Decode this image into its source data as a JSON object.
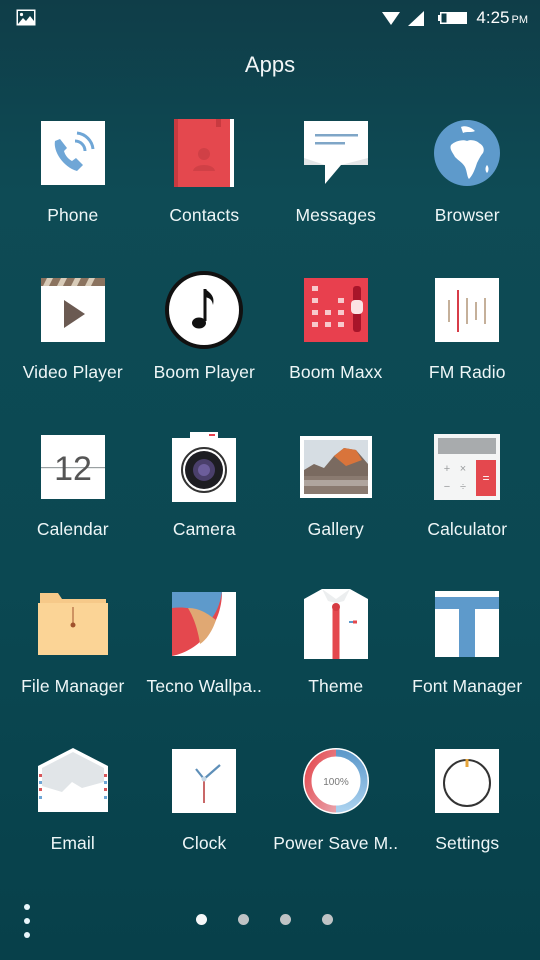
{
  "status_bar": {
    "notification_icon": "image-icon",
    "wifi_icon": "wifi-icon",
    "signal_icon": "cellular-signal-icon",
    "battery_icon": "battery-icon",
    "time": "4:25",
    "ampm": "PM"
  },
  "header": {
    "title": "Apps"
  },
  "apps": [
    {
      "label": "Phone",
      "icon": "phone-icon"
    },
    {
      "label": "Contacts",
      "icon": "contacts-icon"
    },
    {
      "label": "Messages",
      "icon": "messages-icon"
    },
    {
      "label": "Browser",
      "icon": "globe-icon"
    },
    {
      "label": "Video Player",
      "icon": "video-player-icon"
    },
    {
      "label": "Boom Player",
      "icon": "music-note-icon"
    },
    {
      "label": "Boom Maxx",
      "icon": "equalizer-icon"
    },
    {
      "label": "FM Radio",
      "icon": "radio-icon"
    },
    {
      "label": "Calendar",
      "icon": "calendar-icon",
      "date": "12"
    },
    {
      "label": "Camera",
      "icon": "camera-icon"
    },
    {
      "label": "Gallery",
      "icon": "gallery-icon"
    },
    {
      "label": "Calculator",
      "icon": "calculator-icon"
    },
    {
      "label": "File Manager",
      "icon": "folder-icon"
    },
    {
      "label": "Tecno Wallpa..",
      "icon": "wallpaper-icon"
    },
    {
      "label": "Theme",
      "icon": "shirt-icon"
    },
    {
      "label": "Font Manager",
      "icon": "font-icon"
    },
    {
      "label": "Email",
      "icon": "envelope-icon"
    },
    {
      "label": "Clock",
      "icon": "clock-icon"
    },
    {
      "label": "Power Save M..",
      "icon": "battery-gauge-icon",
      "percent": "100%"
    },
    {
      "label": "Settings",
      "icon": "settings-dial-icon"
    }
  ],
  "calculator_keys": [
    "+",
    "×",
    "−",
    "÷",
    "="
  ],
  "footer": {
    "menu_icon": "more-vert-icon",
    "pages": 4,
    "active_page": 1
  },
  "colors": {
    "background": "#0b4852",
    "accent_red": "#e5464c",
    "accent_blue": "#5e9acb"
  }
}
